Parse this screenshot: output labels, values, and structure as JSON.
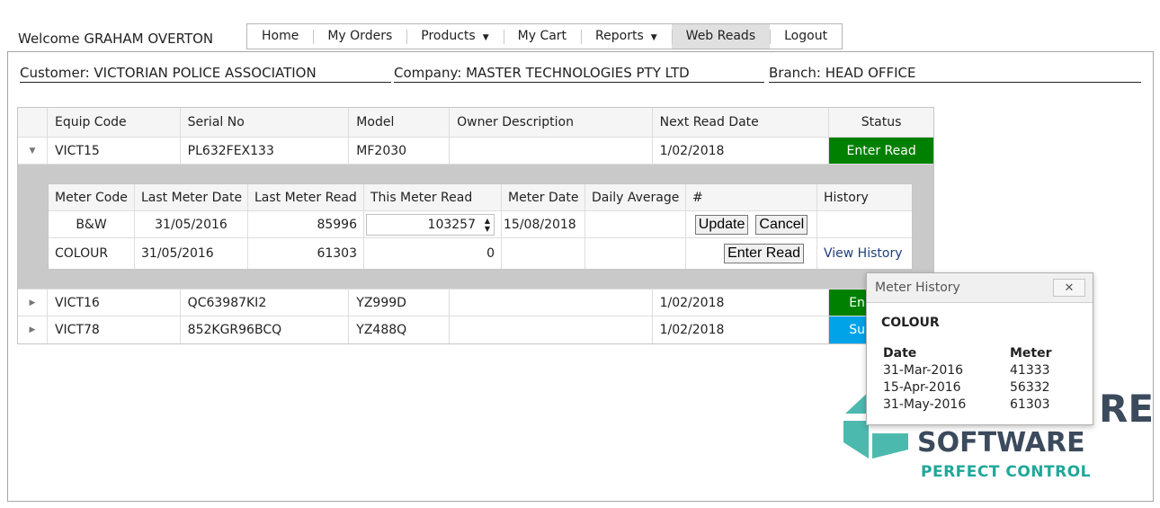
{
  "header": {
    "welcome": "Welcome GRAHAM OVERTON"
  },
  "nav": [
    {
      "label": "Home",
      "dropdown": false,
      "active": false
    },
    {
      "label": "My Orders",
      "dropdown": false,
      "active": false
    },
    {
      "label": "Products",
      "dropdown": true,
      "active": false
    },
    {
      "label": "My Cart",
      "dropdown": false,
      "active": false
    },
    {
      "label": "Reports",
      "dropdown": true,
      "active": false
    },
    {
      "label": "Web Reads",
      "dropdown": false,
      "active": true
    },
    {
      "label": "Logout",
      "dropdown": false,
      "active": false
    }
  ],
  "info": {
    "customer": "Customer: VICTORIAN POLICE ASSOCIATION",
    "company": "Company: MASTER TECHNOLOGIES PTY LTD",
    "branch": "Branch: HEAD OFFICE"
  },
  "grid": {
    "headers": [
      "Equip Code",
      "Serial No",
      "Model",
      "Owner Description",
      "Next Read Date",
      "Status"
    ],
    "rows": [
      {
        "equip": "VICT15",
        "serial": "PL632FEX133",
        "model": "MF2030",
        "owner": "",
        "next_read": "1/02/2018",
        "status": "Enter Read"
      },
      {
        "equip": "VICT16",
        "serial": "QC63987KI2",
        "model": "YZ999D",
        "owner": "",
        "next_read": "1/02/2018",
        "status": "En"
      },
      {
        "equip": "VICT78",
        "serial": "852KGR96BCQ",
        "model": "YZ488Q",
        "owner": "",
        "next_read": "1/02/2018",
        "status": "Su"
      }
    ]
  },
  "meters": {
    "headers": [
      "Meter Code",
      "Last Meter Date",
      "Last Meter Read",
      "This Meter Read",
      "Meter Date",
      "Daily Average",
      "#",
      "History"
    ],
    "rows": [
      {
        "code": "B&W",
        "last_date": "31/05/2016",
        "last_read": "85996",
        "this_read": "103257",
        "meter_date": "15/08/2018",
        "daily_avg": "",
        "update": "Update",
        "cancel": "Cancel",
        "history": ""
      },
      {
        "code": "COLOUR",
        "last_date": "31/05/2016",
        "last_read": "61303",
        "this_read": "0",
        "meter_date": "",
        "daily_avg": "",
        "enter": "Enter Read",
        "history": "View History"
      }
    ]
  },
  "popup": {
    "title": "Meter History",
    "close": "✕",
    "meter": "COLOUR",
    "col_date": "Date",
    "col_meter": "Meter",
    "rows": [
      {
        "date": "31-Mar-2016",
        "meter": "41333"
      },
      {
        "date": "15-Apr-2016",
        "meter": "56332"
      },
      {
        "date": "31-May-2016",
        "meter": "61303"
      }
    ]
  },
  "logo": {
    "line0": "RE",
    "line1": "SOFTWARE",
    "line2": "PERFECT CONTROL",
    "teal": "#1fa79a",
    "dark": "#3b4a5c"
  },
  "icons": {
    "expanded": "▼",
    "collapsed": "▶",
    "caret": "▼",
    "spin_up": "▲",
    "spin_down": "▼"
  }
}
